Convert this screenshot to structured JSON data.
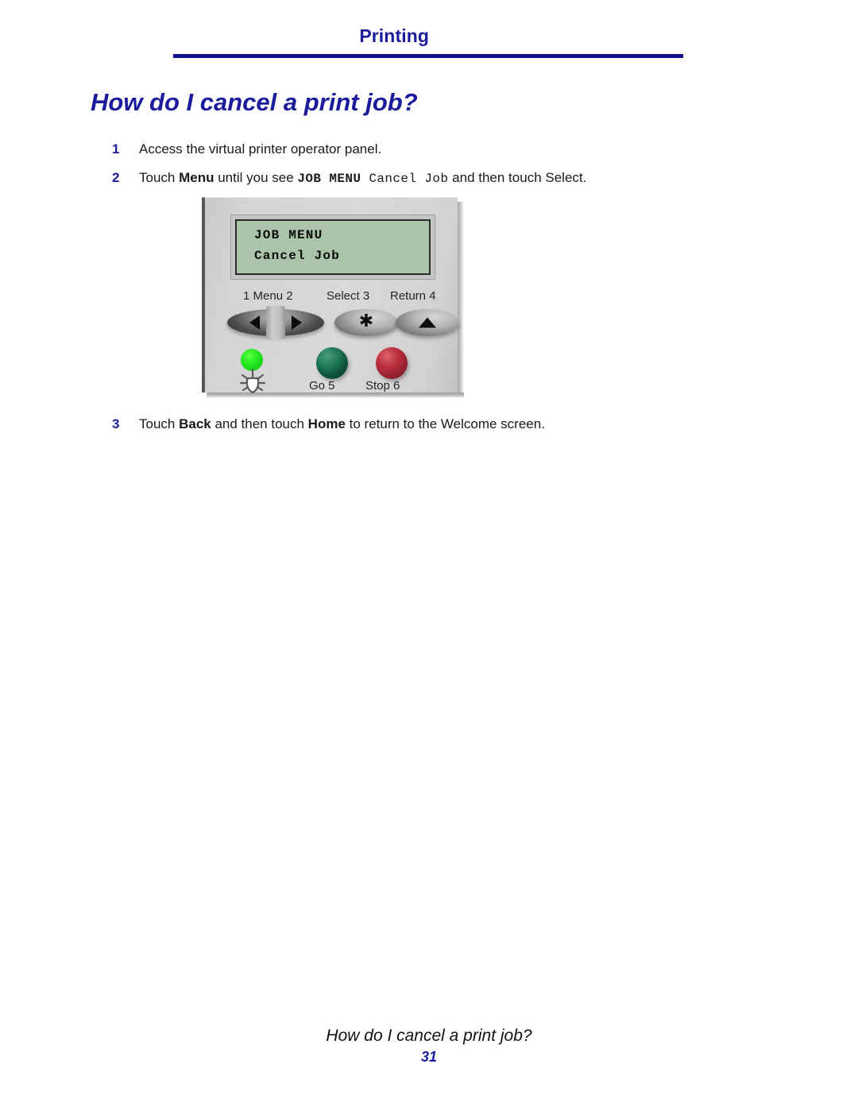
{
  "header": {
    "title": "Printing"
  },
  "section": {
    "title": "How do I cancel a print job?"
  },
  "steps": [
    {
      "number": "1",
      "text": "Access the virtual printer operator panel."
    },
    {
      "number": "2",
      "prefix": "Touch ",
      "bold1": "Menu",
      "middle": " until you see ",
      "mono_bold": "JOB MENU",
      "mono_regular": "Cancel Job",
      "suffix": " and then  touch Select."
    },
    {
      "number": "3",
      "prefix": "Touch ",
      "bold1": "Back",
      "middle": " and then touch ",
      "bold2": "Home",
      "suffix": " to return to the Welcome screen."
    }
  ],
  "operator_panel": {
    "lcd": {
      "line1": "JOB MENU",
      "line2": "Cancel Job",
      "background_color": "#a9c4a9"
    },
    "buttons": [
      {
        "label": "1 Menu 2",
        "name": "menu-button",
        "glyph": "left-right-arrows"
      },
      {
        "label": "Select 3",
        "name": "select-button",
        "glyph": "asterisk"
      },
      {
        "label": "Return 4",
        "name": "return-button",
        "glyph": "up-triangle"
      },
      {
        "label": "Go 5",
        "name": "go-button",
        "color": "#1f7a57"
      },
      {
        "label": "Stop 6",
        "name": "stop-button",
        "color": "#bd303f"
      }
    ],
    "indicator": {
      "name": "status-led",
      "icon": "light-bulb-icon",
      "color": "#1fe41f"
    }
  },
  "footer": {
    "title": "How do I cancel a print job?",
    "page": "31"
  },
  "colors": {
    "accent_navy": "#1b1b9e",
    "rule_navy": "#0d1090",
    "body_text": "#1a1a1a"
  }
}
